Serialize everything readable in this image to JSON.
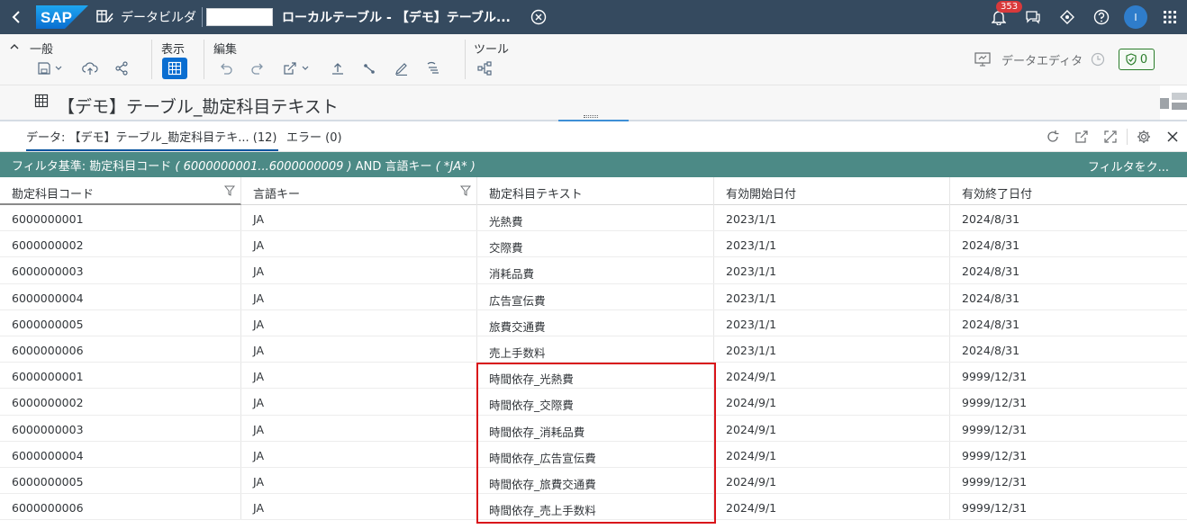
{
  "shell": {
    "logo_text": "SAP",
    "app_name": "データビルダ",
    "title": "ローカルテーブル - 【デモ】テーブル...",
    "notification_count": "353",
    "user_initial": "I"
  },
  "toolbar": {
    "groups": {
      "general": "一般",
      "view": "表示",
      "edit": "編集",
      "tools": "ツール"
    },
    "data_editor_label": "データエディタ",
    "issues_count": "0"
  },
  "object": {
    "name": "【デモ】テーブル_勘定科目テキスト"
  },
  "tabs": {
    "data_tab": "データ: 【デモ】テーブル_勘定科目テキ... (12)",
    "errors_tab": "エラー (0)"
  },
  "filter": {
    "prefix": "フィルタ基準: 勘定科目コード",
    "range": " ( 6000000001...6000000009 ) ",
    "and": "AND 言語キー",
    "lang_value": " ( *JA* )",
    "right_link": "フィルタをク..."
  },
  "table": {
    "columns": [
      "勘定科目コード",
      "言語キー",
      "勘定科目テキスト",
      "有効開始日付",
      "有効終了日付"
    ],
    "rows": [
      [
        "6000000001",
        "JA",
        "光熱費",
        "2023/1/1",
        "2024/8/31"
      ],
      [
        "6000000002",
        "JA",
        "交際費",
        "2023/1/1",
        "2024/8/31"
      ],
      [
        "6000000003",
        "JA",
        "消耗品費",
        "2023/1/1",
        "2024/8/31"
      ],
      [
        "6000000004",
        "JA",
        "広告宣伝費",
        "2023/1/1",
        "2024/8/31"
      ],
      [
        "6000000005",
        "JA",
        "旅費交通費",
        "2023/1/1",
        "2024/8/31"
      ],
      [
        "6000000006",
        "JA",
        "売上手数料",
        "2023/1/1",
        "2024/8/31"
      ],
      [
        "6000000001",
        "JA",
        "時間依存_光熱費",
        "2024/9/1",
        "9999/12/31"
      ],
      [
        "6000000002",
        "JA",
        "時間依存_交際費",
        "2024/9/1",
        "9999/12/31"
      ],
      [
        "6000000003",
        "JA",
        "時間依存_消耗品費",
        "2024/9/1",
        "9999/12/31"
      ],
      [
        "6000000004",
        "JA",
        "時間依存_広告宣伝費",
        "2024/9/1",
        "9999/12/31"
      ],
      [
        "6000000005",
        "JA",
        "時間依存_旅費交通費",
        "2024/9/1",
        "9999/12/31"
      ],
      [
        "6000000006",
        "JA",
        "時間依存_売上手数料",
        "2024/9/1",
        "9999/12/31"
      ]
    ]
  },
  "colors": {
    "shell_bg": "#354a5f",
    "filter_bg": "#4c8a86",
    "accent": "#0a6ed1",
    "highlight": "#d9141a"
  }
}
